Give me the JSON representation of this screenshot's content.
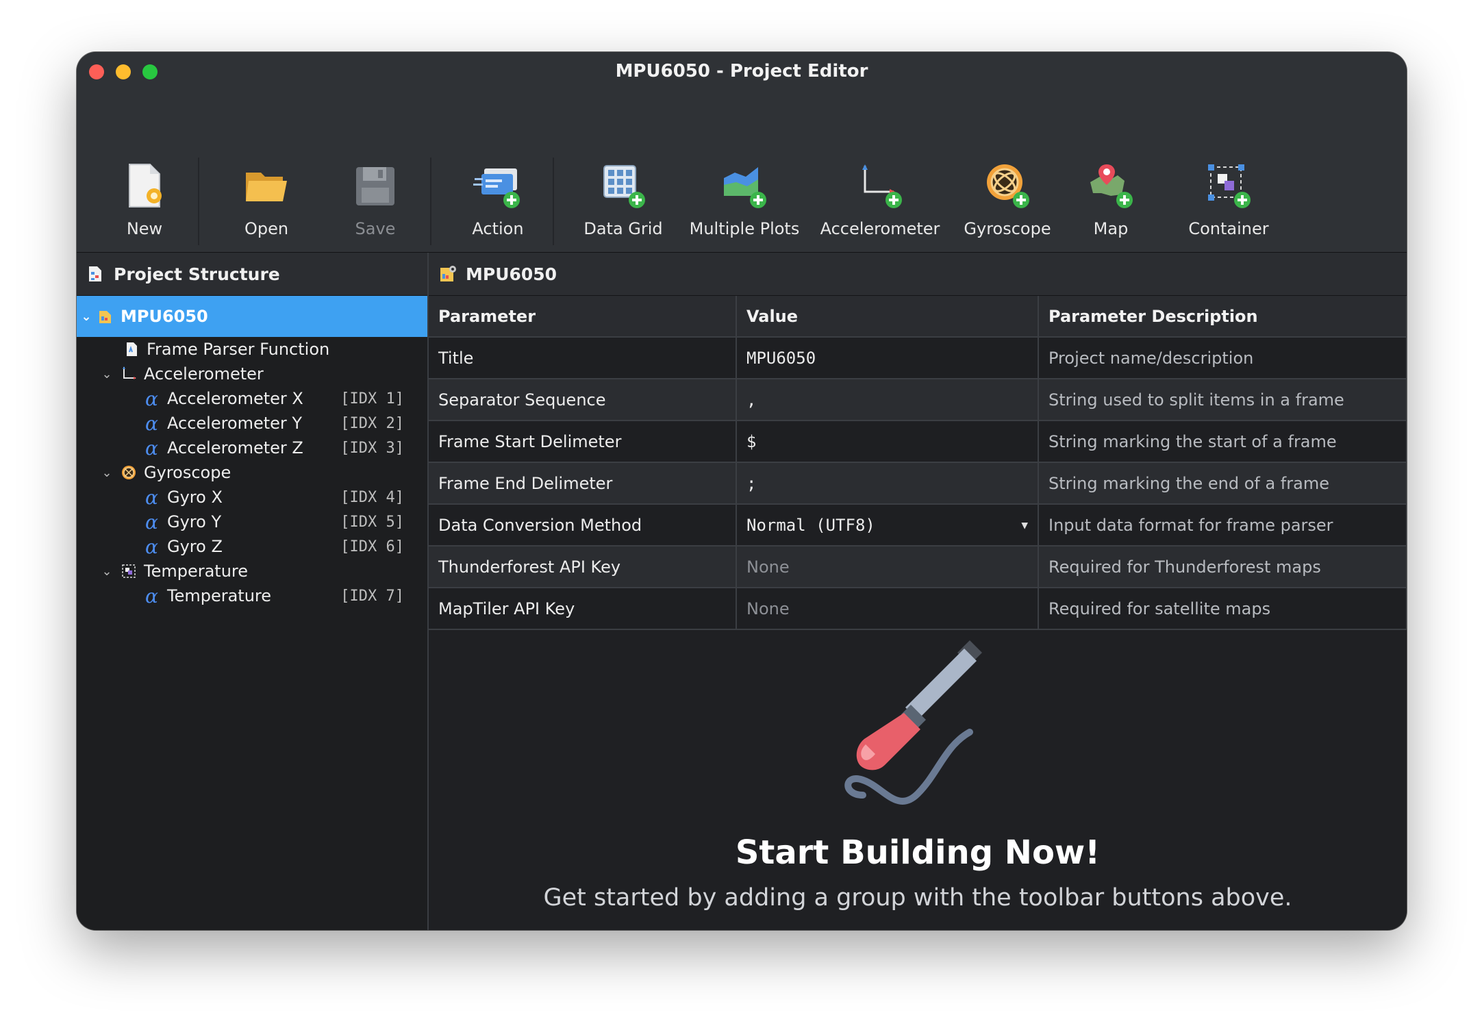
{
  "window": {
    "title": "MPU6050 - Project Editor"
  },
  "toolbar": {
    "new": "New",
    "open": "Open",
    "save": "Save",
    "action": "Action",
    "data_grid": "Data Grid",
    "multiple_plots": "Multiple Plots",
    "accelerometer": "Accelerometer",
    "gyroscope": "Gyroscope",
    "map": "Map",
    "container": "Container"
  },
  "sidebar": {
    "title": "Project Structure",
    "root": "MPU6050",
    "items": [
      {
        "label": "Frame Parser Function"
      },
      {
        "label": "Accelerometer"
      },
      {
        "label": "Accelerometer X",
        "idx": "[IDX 1]"
      },
      {
        "label": "Accelerometer Y",
        "idx": "[IDX 2]"
      },
      {
        "label": "Accelerometer Z",
        "idx": "[IDX 3]"
      },
      {
        "label": "Gyroscope"
      },
      {
        "label": "Gyro X",
        "idx": "[IDX 4]"
      },
      {
        "label": "Gyro Y",
        "idx": "[IDX 5]"
      },
      {
        "label": "Gyro Z",
        "idx": "[IDX 6]"
      },
      {
        "label": "Temperature"
      },
      {
        "label": "Temperature",
        "idx": "[IDX 7]"
      }
    ],
    "alpha_glyph": "α"
  },
  "main": {
    "title": "MPU6050",
    "columns": [
      "Parameter",
      "Value",
      "Parameter Description"
    ],
    "rows": [
      {
        "param": "Title",
        "value": "MPU6050",
        "desc": "Project name/description"
      },
      {
        "param": "Separator Sequence",
        "value": ",",
        "desc": "String used to split items in a frame"
      },
      {
        "param": "Frame Start Delimeter",
        "value": "$",
        "desc": "String marking the start of a frame"
      },
      {
        "param": "Frame End Delimeter",
        "value": ";",
        "desc": "String marking the end of a frame"
      },
      {
        "param": "Data Conversion Method",
        "value": "Normal (UTF8)",
        "desc": "Input data format for frame parser"
      },
      {
        "param": "Thunderforest API Key",
        "value": "None",
        "desc": "Required for Thunderforest maps"
      },
      {
        "param": "MapTiler API Key",
        "value": "None",
        "desc": "Required for satellite maps"
      }
    ],
    "empty_title": "Start Building Now!",
    "empty_subtitle": "Get started by adding a group with the toolbar buttons above."
  },
  "colors": {
    "accent": "#3ea1f2",
    "close": "#fe5f57",
    "minimize": "#febc2e",
    "zoom": "#28c840",
    "alpha": "#4d8df0"
  }
}
